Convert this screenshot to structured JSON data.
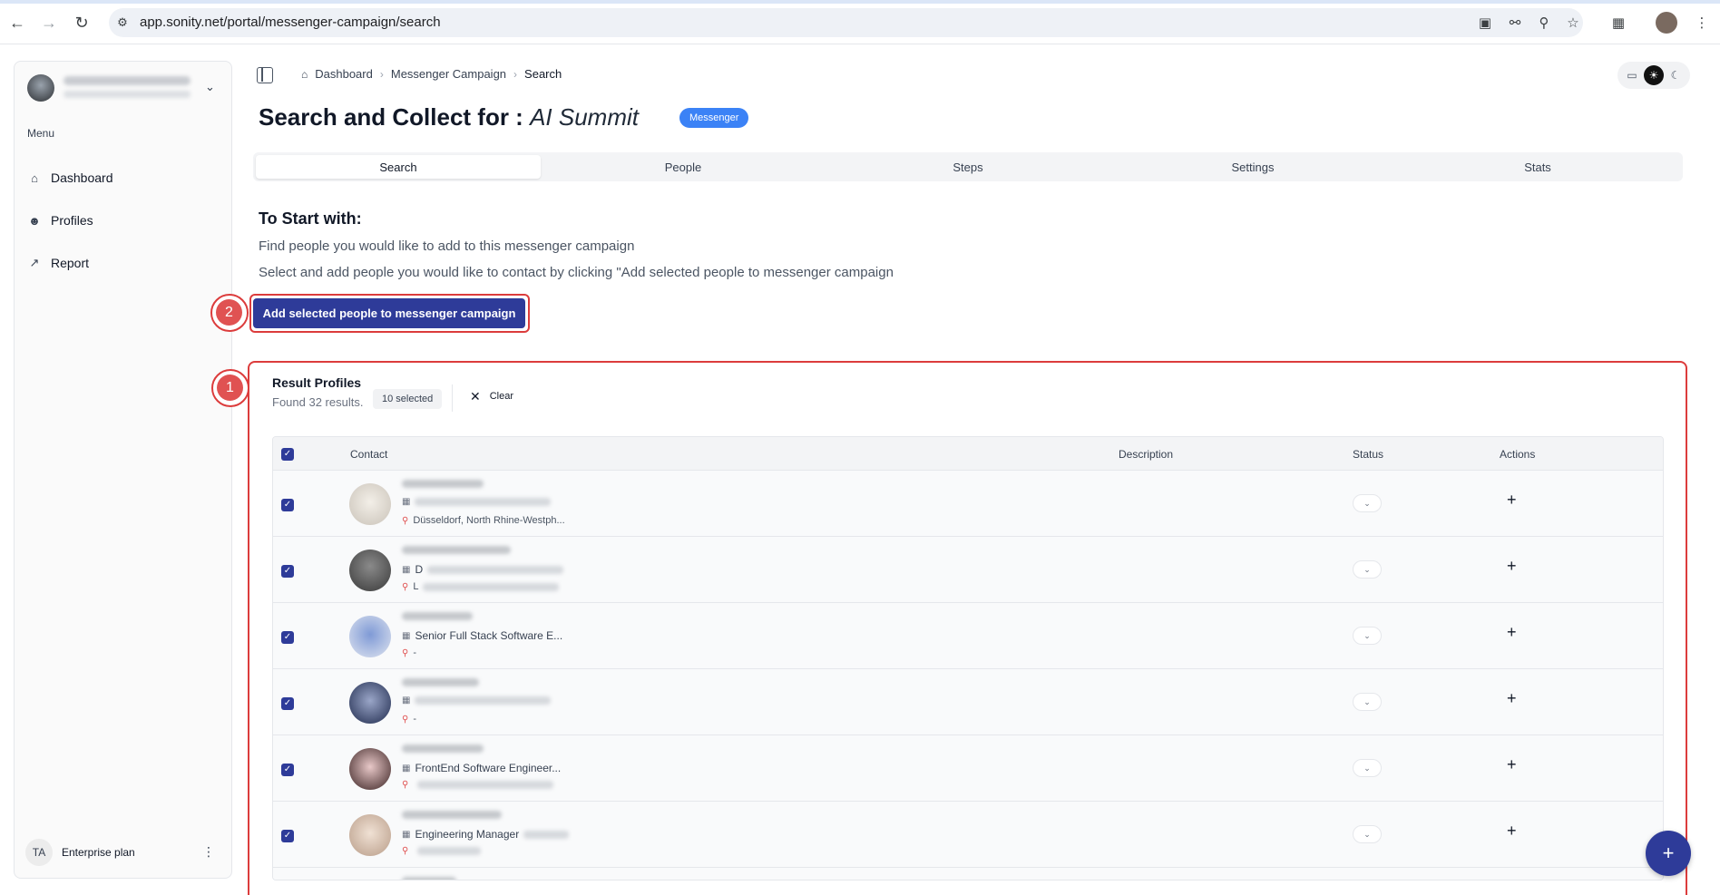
{
  "browser": {
    "url": "app.sonity.net/portal/messenger-campaign/search"
  },
  "sidebar": {
    "menu_heading": "Menu",
    "items": [
      {
        "label": "Dashboard",
        "icon": "home-icon"
      },
      {
        "label": "Profiles",
        "icon": "users-icon"
      },
      {
        "label": "Report",
        "icon": "chart-icon"
      }
    ],
    "plan": {
      "initials": "TA",
      "label": "Enterprise plan"
    }
  },
  "breadcrumb": [
    "Dashboard",
    "Messenger Campaign",
    "Search"
  ],
  "page": {
    "title_prefix": "Search and Collect for : ",
    "title_campaign": "AI Summit",
    "badge": "Messenger"
  },
  "tabs": [
    "Search",
    "People",
    "Steps",
    "Settings",
    "Stats"
  ],
  "intro": {
    "heading": "To Start with:",
    "line1": "Find people you would like to add to this messenger campaign",
    "line2": "Select and add people you would like to contact by clicking \"Add selected people to messenger campaign"
  },
  "add_button": "Add selected people to messenger campaign",
  "markers": {
    "one": "1",
    "two": "2"
  },
  "results": {
    "title": "Result Profiles",
    "count": "Found 32 results.",
    "selected": "10 selected",
    "clear": "Clear",
    "columns": {
      "contact": "Contact",
      "description": "Description",
      "status": "Status",
      "actions": "Actions"
    },
    "rows": [
      {
        "headline": "",
        "location": "Düsseldorf, North Rhine-Westph..."
      },
      {
        "headline": "D",
        "location": "L"
      },
      {
        "headline": "Senior Full Stack Software E...",
        "location": "-"
      },
      {
        "headline": "",
        "location": "-"
      },
      {
        "headline": "FrontEnd Software Engineer...",
        "location": ""
      },
      {
        "headline": "Engineering Manager",
        "location": ""
      }
    ]
  },
  "colors": {
    "primary": "#2e3b99",
    "annotation": "#dc3c3c",
    "badge": "#3b82f6"
  }
}
